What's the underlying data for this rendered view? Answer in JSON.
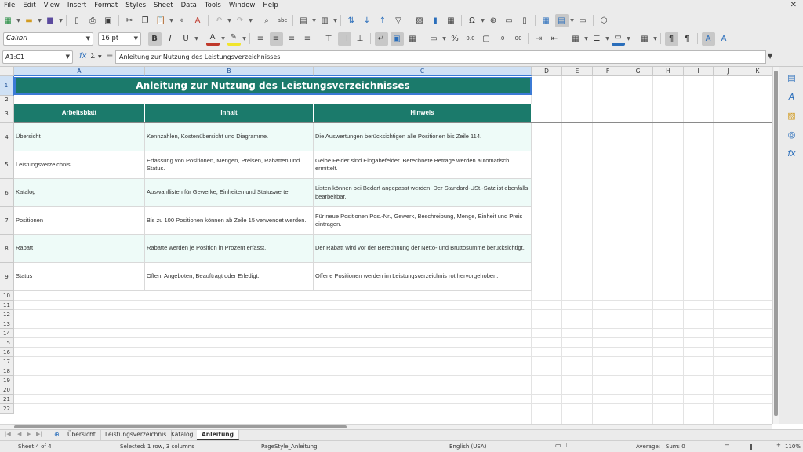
{
  "menu": [
    "File",
    "Edit",
    "View",
    "Insert",
    "Format",
    "Styles",
    "Sheet",
    "Data",
    "Tools",
    "Window",
    "Help"
  ],
  "font": {
    "name": "Calibri",
    "size": "16 pt"
  },
  "namebox": "A1:C1",
  "formula": "Anleitung zur Nutzung des Leistungsverzeichnisses",
  "columns": [
    "A",
    "B",
    "C",
    "D",
    "E",
    "F",
    "G",
    "H",
    "I",
    "J",
    "K"
  ],
  "rows": [
    "1",
    "2",
    "3",
    "4",
    "5",
    "6",
    "7",
    "8",
    "9",
    "10",
    "11",
    "12",
    "13",
    "14",
    "15",
    "16",
    "17",
    "18",
    "19",
    "20",
    "21",
    "22"
  ],
  "sheet": {
    "title": "Anleitung zur Nutzung des Leistungsverzeichnisses",
    "headers": [
      "Arbeitsblatt",
      "Inhalt",
      "Hinweis"
    ],
    "rows": [
      [
        "Übersicht",
        "Kennzahlen, Kostenübersicht und Diagramme.",
        "Die Auswertungen berücksichtigen alle Positionen bis Zeile 114."
      ],
      [
        "Leistungsverzeichnis",
        "Erfassung von Positionen, Mengen, Preisen, Rabatten und Status.",
        "Gelbe Felder sind Eingabefelder. Berechnete Beträge werden automatisch ermittelt."
      ],
      [
        "Katalog",
        "Auswahllisten für Gewerke, Einheiten und Statuswerte.",
        "Listen können bei Bedarf angepasst werden. Der Standard-USt.-Satz ist ebenfalls bearbeitbar."
      ],
      [
        "Positionen",
        "Bis zu 100 Positionen können ab Zeile 15 verwendet werden.",
        "Für neue Positionen Pos.-Nr., Gewerk, Beschreibung, Menge, Einheit und Preis eintragen."
      ],
      [
        "Rabatt",
        "Rabatte werden je Position in Prozent erfasst.",
        "Der Rabatt wird vor der Berechnung der Netto- und Bruttosumme berücksichtigt."
      ],
      [
        "Status",
        "Offen, Angeboten, Beauftragt oder Erledigt.",
        "Offene Positionen werden im Leistungsverzeichnis rot hervorgehoben."
      ]
    ]
  },
  "tabs": [
    "Übersicht",
    "Leistungsverzeichnis",
    "Katalog",
    "Anleitung"
  ],
  "status": {
    "sheet": "Sheet 4 of 4",
    "selection": "Selected: 1 row, 3 columns",
    "page_style": "PageStyle_Anleitung",
    "language": "English (USA)",
    "summary": "Average: ; Sum: 0",
    "zoom": "110%"
  },
  "colors": {
    "accent": "#1b7a6b",
    "tint": "#eefbf8",
    "selection": "#3b7ad5"
  }
}
